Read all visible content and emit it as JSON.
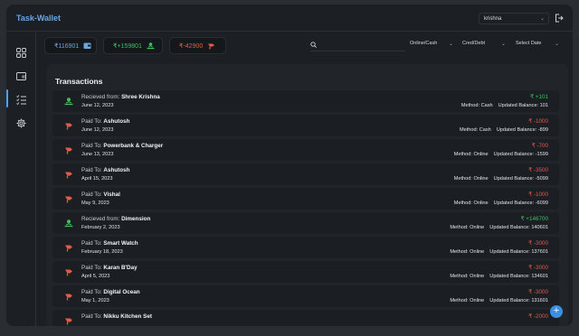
{
  "app": {
    "title": "Task-Wallet"
  },
  "header": {
    "user": "krishna"
  },
  "stats": {
    "balance": "₹116901",
    "credit": "₹+159801",
    "debit": "₹-42900"
  },
  "filters": {
    "search_placeholder": "",
    "mode": "Online/Cash",
    "type": "Cred/Debt",
    "date": "Select Date"
  },
  "colors": {
    "accent": "#6aa6e0",
    "positive": "#3fbf5f",
    "negative": "#e35a48",
    "fab": "#3b8fe0"
  },
  "transactions": {
    "title": "Transactions",
    "rows": [
      {
        "kind": "credit",
        "prefix": "Recieved from:",
        "party": "Shree Krishna",
        "date": "June 12, 2023",
        "amount": "₹ +101",
        "method": "Method: Cash",
        "balance": "Updated Balance: 101"
      },
      {
        "kind": "debit",
        "prefix": "Paid To:",
        "party": "Ashutosh",
        "date": "June 12, 2023",
        "amount": "₹ -1000",
        "method": "Method: Cash",
        "balance": "Updated Balance: -899"
      },
      {
        "kind": "debit",
        "prefix": "Paid To:",
        "party": "Powerbank & Charger",
        "date": "June 13, 2023",
        "amount": "₹ -700",
        "method": "Method: Online",
        "balance": "Updated Balance: -1599"
      },
      {
        "kind": "debit",
        "prefix": "Paid To:",
        "party": "Ashutosh",
        "date": "April 15, 2023",
        "amount": "₹ -3500",
        "method": "Method: Online",
        "balance": "Updated Balance: -5099"
      },
      {
        "kind": "debit",
        "prefix": "Paid To:",
        "party": "Vishal",
        "date": "May 9, 2023",
        "amount": "₹ -1000",
        "method": "Method: Online",
        "balance": "Updated Balance: -6099"
      },
      {
        "kind": "credit",
        "prefix": "Recieved from:",
        "party": "Dimension",
        "date": "February 2, 2023",
        "amount": "₹ +146700",
        "method": "Method: Online",
        "balance": "Updated Balance: 140601"
      },
      {
        "kind": "debit",
        "prefix": "Paid To:",
        "party": "Smart Watch",
        "date": "February 18, 2023",
        "amount": "₹ -3000",
        "method": "Method: Online",
        "balance": "Updated Balance: 137601"
      },
      {
        "kind": "debit",
        "prefix": "Paid To:",
        "party": "Karan B'Day",
        "date": "April 5, 2023",
        "amount": "₹ -3000",
        "method": "Method: Online",
        "balance": "Updated Balance: 134601"
      },
      {
        "kind": "debit",
        "prefix": "Paid To:",
        "party": "Digital Ocean",
        "date": "May 1, 2023",
        "amount": "₹ -3000",
        "method": "Method: Online",
        "balance": "Updated Balance: 131601"
      },
      {
        "kind": "debit",
        "prefix": "Paid To:",
        "party": "Nikku Kitchen Set",
        "date": "",
        "amount": "₹ -2000",
        "method": "",
        "balance": ""
      }
    ]
  },
  "fab": {
    "label": "+"
  },
  "icons": {
    "logout": "logout-icon",
    "nav": [
      "dashboard-icon",
      "wallet-icon",
      "task-list-icon",
      "settings-icon"
    ],
    "credit": "receive-money-icon",
    "debit": "pay-money-icon",
    "search": "search-icon"
  }
}
